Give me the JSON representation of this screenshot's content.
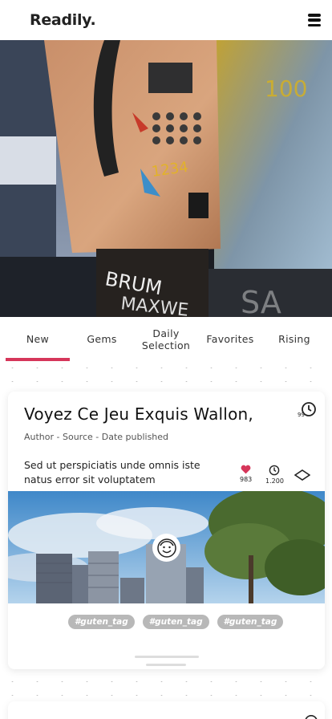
{
  "app": {
    "logo": "Readily."
  },
  "header": {
    "menu_icon": "hamburger-menu-icon"
  },
  "tabs": [
    {
      "label": "New",
      "active": true
    },
    {
      "label": "Gems",
      "active": false
    },
    {
      "label": "Daily Selection",
      "active": false
    },
    {
      "label": "Favorites",
      "active": false
    },
    {
      "label": "Rising",
      "active": false
    }
  ],
  "card": {
    "title": "Voyez Ce Jeu Exquis Wallon,",
    "timer_value": "99",
    "meta": "Author - Source - Date published",
    "description": "Sed ut perspiciatis unde omnis iste natus error sit voluptatem",
    "likes": "983",
    "views": "1.200",
    "tags": [
      "#guten_tag",
      "#guten_tag",
      "#guten_tag"
    ]
  },
  "colors": {
    "accent": "#d6365a",
    "tag_bg": "#b8b8b8"
  }
}
